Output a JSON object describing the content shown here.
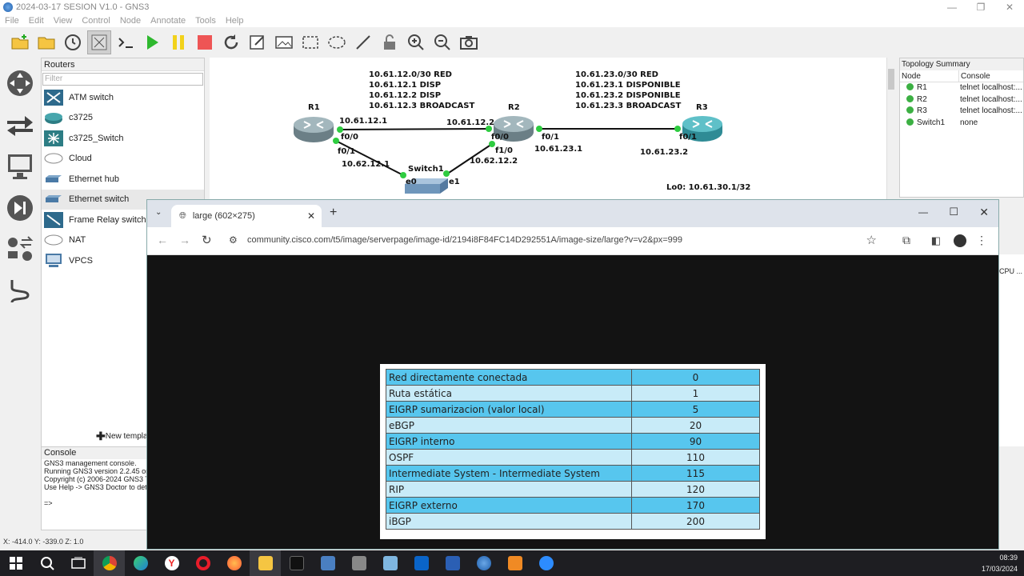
{
  "gns3": {
    "window_title": "2024-03-17 SESION V1.0 - GNS3",
    "menu": [
      "File",
      "Edit",
      "View",
      "Control",
      "Node",
      "Annotate",
      "Tools",
      "Help"
    ],
    "routers_dock_title": "Routers",
    "filter_placeholder": "Filter",
    "devices": [
      "ATM switch",
      "c3725",
      "c3725_Switch",
      "Cloud",
      "Ethernet hub",
      "Ethernet switch",
      "Frame Relay switch",
      "NAT",
      "VPCS"
    ],
    "new_template": "New template",
    "console_title": "Console",
    "console_lines": [
      "GNS3 management console.",
      "Running GNS3 version 2.2.45 on",
      "Copyright (c) 2006-2024 GNS3 Te",
      "Use Help -> GNS3 Doctor to dete",
      "",
      "=>"
    ],
    "status": "X: -414.0 Y: -339.0 Z: 1.0",
    "topology_summary": {
      "title": "Topology Summary",
      "col_node": "Node",
      "col_console": "Console",
      "rows": [
        {
          "node": "R1",
          "console": "telnet localhost:..."
        },
        {
          "node": "R2",
          "console": "telnet localhost:..."
        },
        {
          "node": "R3",
          "console": "telnet localhost:..."
        },
        {
          "node": "Switch1",
          "console": "none"
        }
      ]
    },
    "right_lower_label": "CPU ...",
    "topology": {
      "net12": "10.61.12.0/30 RED\n10.61.12.1 DISP\n10.61.12.2 DISP\n10.61.12.3 BROADCAST",
      "net23": "10.61.23.0/30 RED\n10.61.23.1 DISPONIBLE\n10.61.23.2 DISPONIBLE\n10.61.23.3 BROADCAST",
      "r1": "R1",
      "r2": "R2",
      "r3": "R3",
      "switch1": "Switch1",
      "r1_ip": "10.61.12.1",
      "r2_ip12": "10.61.12.2",
      "r1_f00": "f0/0",
      "r1_f01": "f0/1",
      "r1_ip62": "10.62.12.1",
      "r2_f00": "f0/0",
      "r2_f10": "f1/0",
      "r2_ip62": "10.62.12.2",
      "r2_f01": "f0/1",
      "r2_ip23": "10.61.23.1",
      "r3_f01": "f0/1",
      "r3_ip23": "10.61.23.2",
      "lo0": "Lo0: 10.61.30.1/32",
      "sw_e0": "e0",
      "sw_e1": "e1"
    }
  },
  "chrome": {
    "tab_title": "large (602×275)",
    "url": "community.cisco.com/t5/image/serverpage/image-id/2194i8F84FC14D292551A/image-size/large?v=v2&px=999"
  },
  "ad_table": [
    {
      "route": "Red directamente conectada",
      "ad": "0"
    },
    {
      "route": "Ruta estática",
      "ad": "1"
    },
    {
      "route": "EIGRP sumarizacion (valor local)",
      "ad": "5"
    },
    {
      "route": "eBGP",
      "ad": "20"
    },
    {
      "route": "EIGRP interno",
      "ad": "90"
    },
    {
      "route": "OSPF",
      "ad": "110"
    },
    {
      "route": "Intermediate System - Intermediate System",
      "ad": "115"
    },
    {
      "route": "RIP",
      "ad": "120"
    },
    {
      "route": "EIGRP externo",
      "ad": "170"
    },
    {
      "route": "iBGP",
      "ad": "200"
    }
  ],
  "taskbar": {
    "time": "08:39",
    "date": "17/03/2024"
  }
}
